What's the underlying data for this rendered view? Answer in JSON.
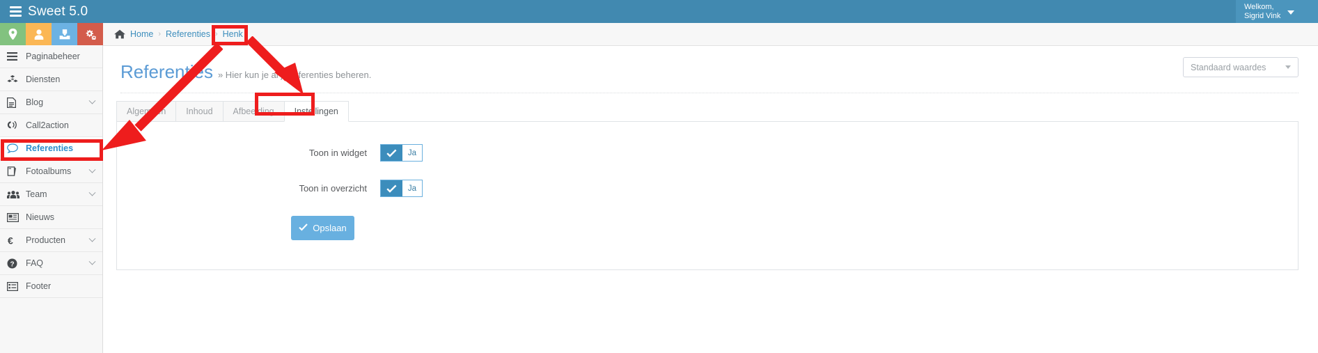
{
  "topbar": {
    "brand": "Sweet 5.0",
    "brand_icon": "server-stack-icon",
    "user_greeting": "Welkom,",
    "user_name": "Sigrid Vink",
    "caret_icon": "caret-down-icon"
  },
  "quick_actions": [
    {
      "name": "location-pin-icon",
      "color": "#82c27f"
    },
    {
      "name": "user-icon",
      "color": "#fbb755"
    },
    {
      "name": "download-inbox-icon",
      "color": "#6cb2e3"
    },
    {
      "name": "gears-icon",
      "color": "#d35c4b"
    }
  ],
  "sidebar": {
    "items": [
      {
        "label": "Paginabeheer",
        "icon": "bars-icon",
        "caret": false,
        "active": false
      },
      {
        "label": "Diensten",
        "icon": "cubes-icon",
        "caret": false,
        "active": false
      },
      {
        "label": "Blog",
        "icon": "file-text-icon",
        "caret": true,
        "active": false
      },
      {
        "label": "Call2action",
        "icon": "bullhorn-icon",
        "caret": false,
        "active": false
      },
      {
        "label": "Referenties",
        "icon": "comment-icon",
        "caret": false,
        "active": true
      },
      {
        "label": "Fotoalbums",
        "icon": "book-icon",
        "caret": true,
        "active": false
      },
      {
        "label": "Team",
        "icon": "users-icon",
        "caret": true,
        "active": false
      },
      {
        "label": "Nieuws",
        "icon": "newspaper-icon",
        "caret": false,
        "active": false
      },
      {
        "label": "Producten",
        "icon": "euro-icon",
        "caret": true,
        "active": false
      },
      {
        "label": "FAQ",
        "icon": "question-circle-icon",
        "caret": true,
        "active": false
      },
      {
        "label": "Footer",
        "icon": "list-alt-icon",
        "caret": false,
        "active": false
      }
    ]
  },
  "breadcrumb": {
    "home_icon": "home-icon",
    "home": "Home",
    "separator": "›",
    "parent": "Referenties",
    "current": "Henk"
  },
  "page": {
    "title": "Referenties",
    "subtitle": "» Hier kun je al je referenties beheren.",
    "default_select_value": "Standaard waardes"
  },
  "tabs": [
    {
      "label": "Algemeen",
      "active": false
    },
    {
      "label": "Inhoud",
      "active": false
    },
    {
      "label": "Afbeelding",
      "active": false
    },
    {
      "label": "Instellingen",
      "active": true
    }
  ],
  "form": {
    "rows": [
      {
        "label": "Toon in widget",
        "value": "Ja",
        "checked": true
      },
      {
        "label": "Toon in overzicht",
        "value": "Ja",
        "checked": true
      }
    ],
    "save_label": "Opslaan",
    "save_icon": "check-icon"
  },
  "colors": {
    "brand_bar": "#4189b0",
    "accent": "#3c8dbc",
    "save_button": "#68b0e0",
    "annotation": "#ee1d1d"
  },
  "annotations": [
    {
      "name": "highlight-breadcrumb-henk"
    },
    {
      "name": "highlight-sidebar-referenties"
    },
    {
      "name": "highlight-tab-instellingen"
    },
    {
      "name": "arrow-to-sidebar-referenties"
    },
    {
      "name": "arrow-to-tab-instellingen"
    }
  ]
}
